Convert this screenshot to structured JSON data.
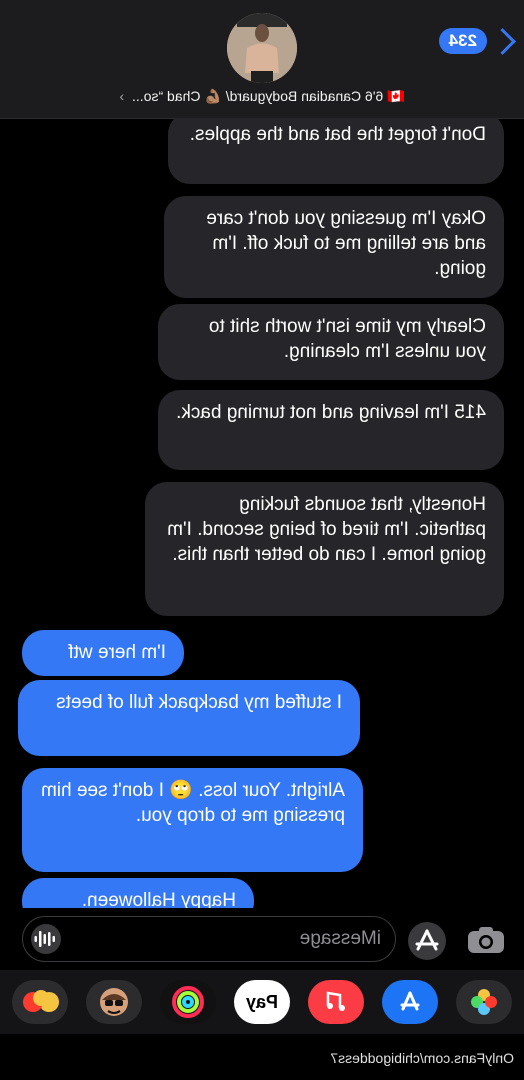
{
  "header": {
    "back_count": "234",
    "contact_name": "🇨🇦 6'6 Canadian Bodyguard/ 💪🏽 Chad “so...",
    "contact_chevron": "›"
  },
  "messages": [
    {
      "dir": "in",
      "text": "Don't forget the bat and the apples."
    },
    {
      "dir": "in",
      "text": "Okay I'm guessing you don't care and are telling me to fuck off. I'm going."
    },
    {
      "dir": "in",
      "text": "Clearly my time isn't worth shit to you unless I'm cleaning."
    },
    {
      "dir": "in",
      "text": "415 I'm leaving and not turning back."
    },
    {
      "dir": "in",
      "text": "Honestly, that sounds fucking pathetic. I'm tired of being second. I'm going home. I can do better than this."
    },
    {
      "dir": "out",
      "text": "I'm here wtf"
    },
    {
      "dir": "out",
      "text": "I stuffed my backpack full of beets"
    },
    {
      "dir": "out",
      "text": "Alright. Your loss. 🙄 I don't see him pressing me to drop you."
    },
    {
      "dir": "out",
      "text": "Happy Halloween."
    }
  ],
  "composer": {
    "placeholder": "iMessage"
  },
  "apps": [
    {
      "name": "photos",
      "label": ""
    },
    {
      "name": "app-store",
      "label": ""
    },
    {
      "name": "music",
      "label": ""
    },
    {
      "name": "apple-pay",
      "label": " Pay"
    },
    {
      "name": "activity",
      "label": ""
    },
    {
      "name": "memoji",
      "label": ""
    },
    {
      "name": "emoji-stickers",
      "label": ""
    }
  ],
  "footer": {
    "watermark": "OnlyFans.com/chibigoddess7"
  },
  "colors": {
    "accent": "#3478f6",
    "incoming": "#26262a",
    "outgoing": "#3478f6"
  }
}
